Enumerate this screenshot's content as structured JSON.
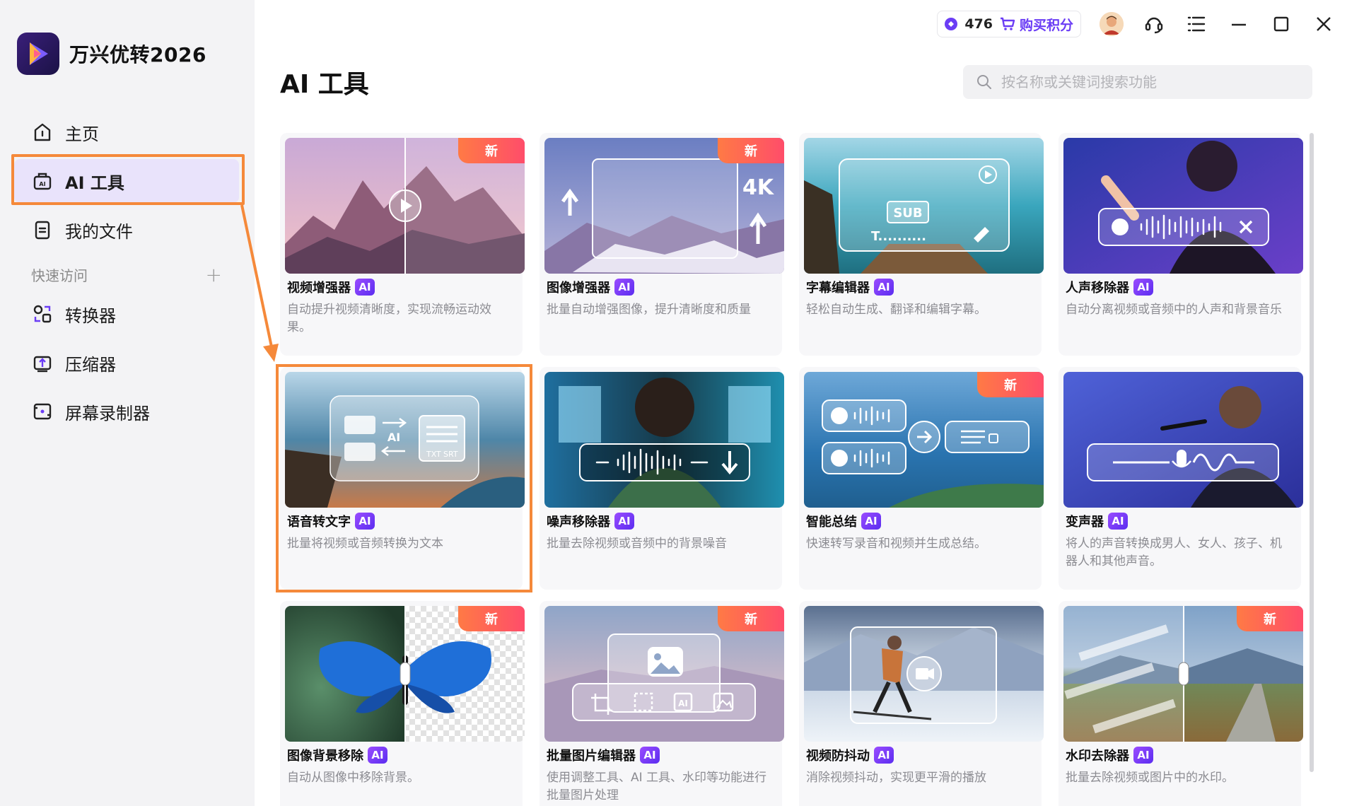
{
  "app": {
    "name": "万兴优转2026"
  },
  "sidebar": {
    "items": [
      {
        "label": "主页",
        "icon": "home-icon"
      },
      {
        "label": "AI 工具",
        "icon": "ai-toolbox-icon",
        "active": true
      },
      {
        "label": "我的文件",
        "icon": "file-icon"
      }
    ],
    "quick_access_label": "快速访问",
    "quick_items": [
      {
        "label": "转换器",
        "icon": "converter-icon"
      },
      {
        "label": "压缩器",
        "icon": "compressor-icon"
      },
      {
        "label": "屏幕录制器",
        "icon": "screen-recorder-icon"
      }
    ]
  },
  "topbar": {
    "points": "476",
    "buy_label": "购买积分"
  },
  "page": {
    "title": "AI 工具"
  },
  "search": {
    "placeholder": "按名称或关键词搜索功能"
  },
  "ai_badge": "AI",
  "new_badge": "新",
  "cards": [
    {
      "name": "视频增强器",
      "desc": "自动提升视频清晰度，实现流畅运动效果。",
      "new": true
    },
    {
      "name": "图像增强器",
      "desc": "批量自动增强图像，提升清晰度和质量",
      "new": true
    },
    {
      "name": "字幕编辑器",
      "desc": "轻松自动生成、翻译和编辑字幕。",
      "new": false
    },
    {
      "name": "人声移除器",
      "desc": "自动分离视频或音频中的人声和背景音乐",
      "new": false
    },
    {
      "name": "语音转文字",
      "desc": "批量将视频或音频转换为文本",
      "new": false
    },
    {
      "name": "噪声移除器",
      "desc": "批量去除视频或音频中的背景噪音",
      "new": false
    },
    {
      "name": "智能总结",
      "desc": "快速转写录音和视频并生成总结。",
      "new": true
    },
    {
      "name": "变声器",
      "desc": "将人的声音转换成男人、女人、孩子、机器人和其他声音。",
      "new": false
    },
    {
      "name": "图像背景移除",
      "desc": "自动从图像中移除背景。",
      "new": true
    },
    {
      "name": "批量图片编辑器",
      "desc": "使用调整工具、AI 工具、水印等功能进行批量图片处理",
      "new": true
    },
    {
      "name": "视频防抖动",
      "desc": "消除视频抖动，实现更平滑的播放",
      "new": false
    },
    {
      "name": "水印去除器",
      "desc": "批量去除视频或图片中的水印。",
      "new": true
    }
  ],
  "thumb_texts": {
    "k4": "4K",
    "sub": "SUB",
    "tline": "T..........",
    "ai": "AI",
    "txt": "TXT",
    "srt": "SRT"
  },
  "colors": {
    "accent": "#6b3df5",
    "highlight": "#f5893a",
    "new_badge": "#ff5a5a"
  }
}
